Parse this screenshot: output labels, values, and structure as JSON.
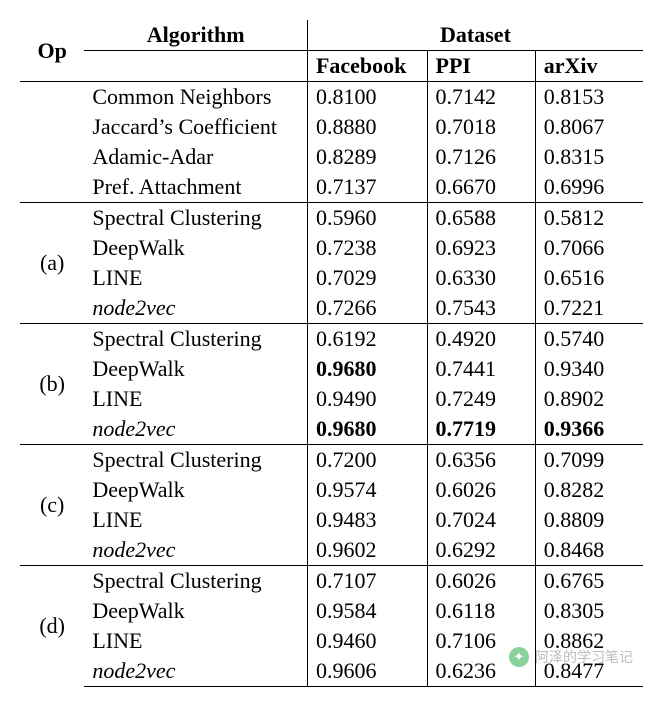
{
  "header": {
    "op": "Op",
    "algorithm": "Algorithm",
    "dataset": "Dataset",
    "cols": [
      "Facebook",
      "PPI",
      "arXiv"
    ]
  },
  "groups": [
    {
      "op": "",
      "rows": [
        {
          "algo": "Common Neighbors",
          "italic": false,
          "vals": [
            [
              "0.8100",
              false
            ],
            [
              "0.7142",
              false
            ],
            [
              "0.8153",
              false
            ]
          ]
        },
        {
          "algo": "Jaccard’s Coefficient",
          "italic": false,
          "vals": [
            [
              "0.8880",
              false
            ],
            [
              "0.7018",
              false
            ],
            [
              "0.8067",
              false
            ]
          ]
        },
        {
          "algo": "Adamic-Adar",
          "italic": false,
          "vals": [
            [
              "0.8289",
              false
            ],
            [
              "0.7126",
              false
            ],
            [
              "0.8315",
              false
            ]
          ]
        },
        {
          "algo": "Pref. Attachment",
          "italic": false,
          "vals": [
            [
              "0.7137",
              false
            ],
            [
              "0.6670",
              false
            ],
            [
              "0.6996",
              false
            ]
          ]
        }
      ]
    },
    {
      "op": "(a)",
      "rows": [
        {
          "algo": "Spectral Clustering",
          "italic": false,
          "vals": [
            [
              "0.5960",
              false
            ],
            [
              "0.6588",
              false
            ],
            [
              "0.5812",
              false
            ]
          ]
        },
        {
          "algo": "DeepWalk",
          "italic": false,
          "vals": [
            [
              "0.7238",
              false
            ],
            [
              "0.6923",
              false
            ],
            [
              "0.7066",
              false
            ]
          ]
        },
        {
          "algo": "LINE",
          "italic": false,
          "vals": [
            [
              "0.7029",
              false
            ],
            [
              "0.6330",
              false
            ],
            [
              "0.6516",
              false
            ]
          ]
        },
        {
          "algo": "node2vec",
          "italic": true,
          "vals": [
            [
              "0.7266",
              false
            ],
            [
              "0.7543",
              false
            ],
            [
              "0.7221",
              false
            ]
          ]
        }
      ]
    },
    {
      "op": "(b)",
      "rows": [
        {
          "algo": "Spectral Clustering",
          "italic": false,
          "vals": [
            [
              "0.6192",
              false
            ],
            [
              "0.4920",
              false
            ],
            [
              "0.5740",
              false
            ]
          ]
        },
        {
          "algo": "DeepWalk",
          "italic": false,
          "vals": [
            [
              "0.9680",
              true
            ],
            [
              "0.7441",
              false
            ],
            [
              "0.9340",
              false
            ]
          ]
        },
        {
          "algo": "LINE",
          "italic": false,
          "vals": [
            [
              "0.9490",
              false
            ],
            [
              "0.7249",
              false
            ],
            [
              "0.8902",
              false
            ]
          ]
        },
        {
          "algo": "node2vec",
          "italic": true,
          "vals": [
            [
              "0.9680",
              true
            ],
            [
              "0.7719",
              true
            ],
            [
              "0.9366",
              true
            ]
          ]
        }
      ]
    },
    {
      "op": "(c)",
      "rows": [
        {
          "algo": "Spectral Clustering",
          "italic": false,
          "vals": [
            [
              "0.7200",
              false
            ],
            [
              "0.6356",
              false
            ],
            [
              "0.7099",
              false
            ]
          ]
        },
        {
          "algo": "DeepWalk",
          "italic": false,
          "vals": [
            [
              "0.9574",
              false
            ],
            [
              "0.6026",
              false
            ],
            [
              "0.8282",
              false
            ]
          ]
        },
        {
          "algo": "LINE",
          "italic": false,
          "vals": [
            [
              "0.9483",
              false
            ],
            [
              "0.7024",
              false
            ],
            [
              "0.8809",
              false
            ]
          ]
        },
        {
          "algo": "node2vec",
          "italic": true,
          "vals": [
            [
              "0.9602",
              false
            ],
            [
              "0.6292",
              false
            ],
            [
              "0.8468",
              false
            ]
          ]
        }
      ]
    },
    {
      "op": "(d)",
      "rows": [
        {
          "algo": "Spectral Clustering",
          "italic": false,
          "vals": [
            [
              "0.7107",
              false
            ],
            [
              "0.6026",
              false
            ],
            [
              "0.6765",
              false
            ]
          ]
        },
        {
          "algo": "DeepWalk",
          "italic": false,
          "vals": [
            [
              "0.9584",
              false
            ],
            [
              "0.6118",
              false
            ],
            [
              "0.8305",
              false
            ]
          ]
        },
        {
          "algo": "LINE",
          "italic": false,
          "vals": [
            [
              "0.9460",
              false
            ],
            [
              "0.7106",
              false
            ],
            [
              "0.8862",
              false
            ]
          ]
        },
        {
          "algo": "node2vec",
          "italic": true,
          "vals": [
            [
              "0.9606",
              false
            ],
            [
              "0.6236",
              false
            ],
            [
              "0.8477",
              false
            ]
          ]
        }
      ]
    }
  ],
  "watermark": "阿泽的学习笔记"
}
